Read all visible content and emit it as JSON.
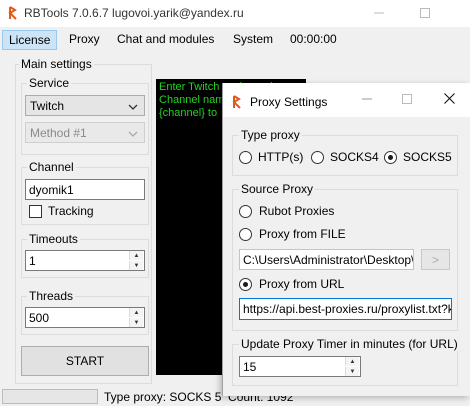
{
  "window": {
    "title": "RBTools 7.0.6.7 lugovoi.yarik@yandex.ru"
  },
  "menu": {
    "items": [
      "License",
      "Proxy",
      "Chat and modules",
      "System",
      "00:00:00"
    ]
  },
  "main_settings": {
    "label": "Main settings",
    "service": {
      "label": "Service",
      "value": "Twitch",
      "method_value": "Method #1"
    },
    "channel": {
      "label": "Channel",
      "value": "dyomik1",
      "tracking_label": "Tracking"
    },
    "timeouts": {
      "label": "Timeouts",
      "value": "1"
    },
    "threads": {
      "label": "Threads",
      "value": "500"
    },
    "start_label": "START"
  },
  "console": {
    "lines": [
      "Enter Twitch tv channel name",
      "Channel nam",
      "{channel} to"
    ]
  },
  "status": {
    "text": "Type proxy: SOCKS 5  Count: 1092"
  },
  "dialog": {
    "title": "Proxy Settings",
    "type_proxy": {
      "label": "Type proxy",
      "options": [
        "HTTP(s)",
        "SOCKS4",
        "SOCKS5"
      ],
      "selected": "SOCKS5"
    },
    "source_proxy": {
      "label": "Source Proxy",
      "options": [
        "Rubot Proxies",
        "Proxy from FILE",
        "Proxy from URL"
      ],
      "selected": "Proxy from URL",
      "file_path": "C:\\Users\\Administrator\\Desktop\\htt",
      "browse_label": ">",
      "url": "https://api.best-proxies.ru/proxylist.txt?key="
    },
    "timer": {
      "label": "Update Proxy Timer in minutes (for URL)",
      "value": "15"
    }
  },
  "colors": {
    "accent": "#0078d7",
    "console_bg": "#000000",
    "console_text": "#25d125",
    "menu_highlight": "#cce4f7"
  }
}
